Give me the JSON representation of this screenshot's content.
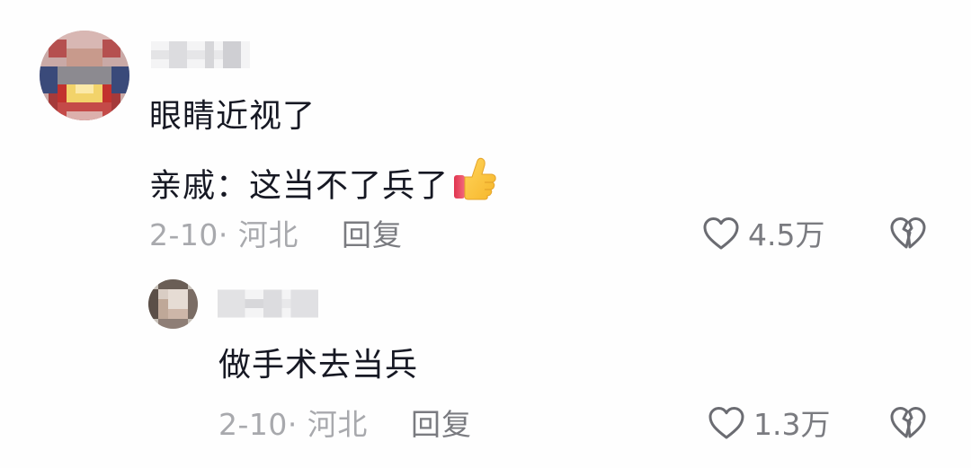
{
  "comment": {
    "text_line1": "眼睛近视了",
    "text_line2": "亲戚：这当不了兵了",
    "emoji": "thumbs-up",
    "date_location": "2-10· 河北",
    "reply_label": "回复",
    "likes": "4.5万"
  },
  "reply": {
    "text": "做手术去当兵",
    "date_location": "2-10· 河北",
    "reply_label": "回复",
    "likes": "1.3万"
  },
  "colors": {
    "text": "#161823",
    "meta": "#a8a9ad",
    "action": "#7a7b80",
    "icon": "#6b6c72"
  }
}
